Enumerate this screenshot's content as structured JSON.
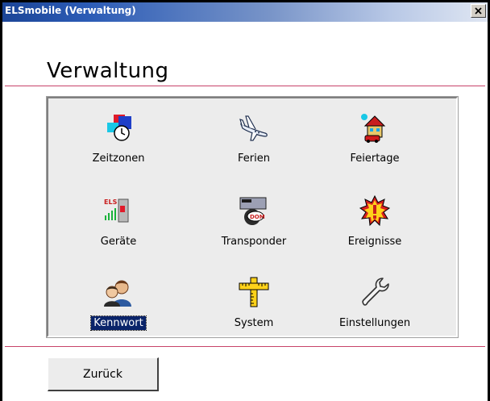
{
  "window": {
    "title": "ELSmobile (Verwaltung)",
    "close_symbol": "×"
  },
  "page": {
    "heading": "Verwaltung"
  },
  "tiles": [
    {
      "label": "Zeitzonen",
      "icon": "time-zones-icon"
    },
    {
      "label": "Ferien",
      "icon": "airplane-icon"
    },
    {
      "label": "Feiertage",
      "icon": "house-icon"
    },
    {
      "label": "Geräte",
      "icon": "device-reader-icon"
    },
    {
      "label": "Transponder",
      "icon": "transponder-icon"
    },
    {
      "label": "Ereignisse",
      "icon": "alert-icon"
    },
    {
      "label": "Kennwort",
      "icon": "users-icon",
      "selected": true
    },
    {
      "label": "System",
      "icon": "ruler-cross-icon"
    },
    {
      "label": "Einstellungen",
      "icon": "wrench-icon"
    }
  ],
  "footer": {
    "back_label": "Zurück"
  },
  "colors": {
    "title_bar": "#1c4597",
    "divider": "#c8436a",
    "selection": "#0a246a"
  }
}
